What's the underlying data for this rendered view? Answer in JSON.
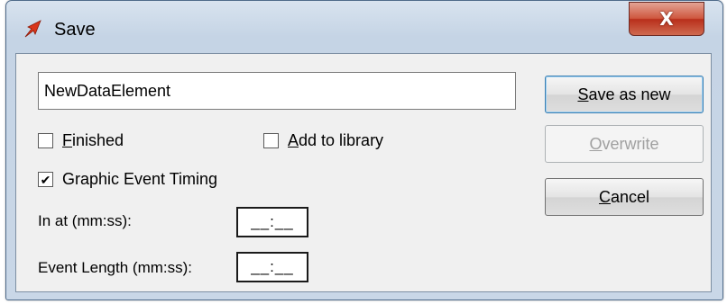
{
  "window": {
    "title": "Save",
    "icon": "red-arrow-icon",
    "close_glyph": "X"
  },
  "form": {
    "name_value": "NewDataElement",
    "finished": {
      "label_first": "F",
      "label_rest": "inished",
      "checked": false
    },
    "add_library": {
      "label_first": "A",
      "label_rest": "dd to library",
      "checked": false
    },
    "graphic_timing": {
      "label": "Graphic Event Timing",
      "checked": true
    },
    "in_at_label": "In at (mm:ss):",
    "in_at_value": "__:__",
    "event_length_label": "Event Length (mm:ss):",
    "event_length_value": "__:__"
  },
  "buttons": {
    "save_new_first": "S",
    "save_new_rest": "ave as new",
    "overwrite_first": "O",
    "overwrite_rest": "verwrite",
    "cancel_first": "C",
    "cancel_rest": "ancel"
  },
  "colors": {
    "accent": "#3c7fb1",
    "close": "#c7432b",
    "frame": "#c9d7e7"
  }
}
